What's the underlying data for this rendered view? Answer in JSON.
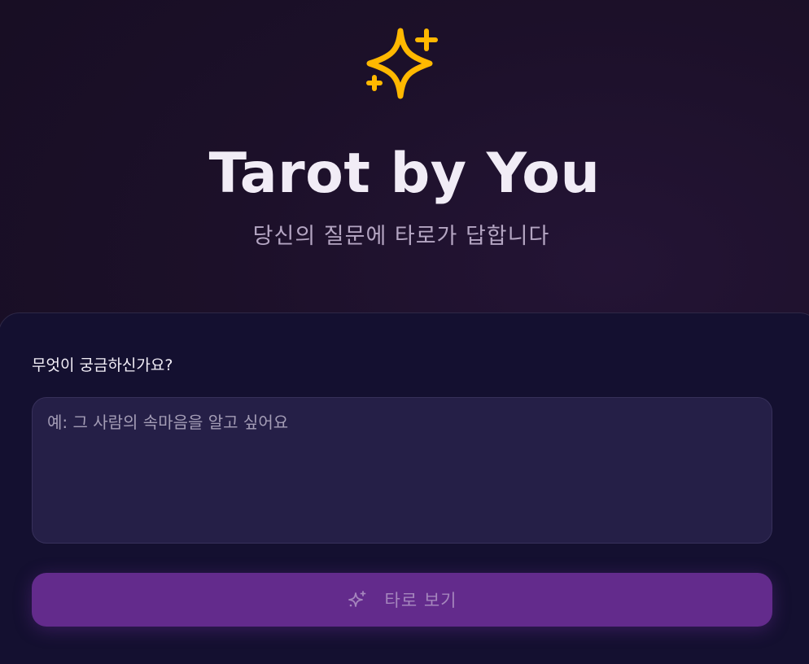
{
  "app": {
    "title": "Tarot by You",
    "subtitle": "당신의 질문에 타로가 답합니다",
    "logo_icon": "sparkles-icon",
    "accent_color": "#ffb800"
  },
  "form": {
    "question_label": "무엇이 궁금하신가요?",
    "question_placeholder": "예: 그 사람의 속마음을 알고 싶어요",
    "question_value": "",
    "submit_label": "타로 보기",
    "submit_icon": "sparkles-icon",
    "submit_color": "#632b8c"
  }
}
